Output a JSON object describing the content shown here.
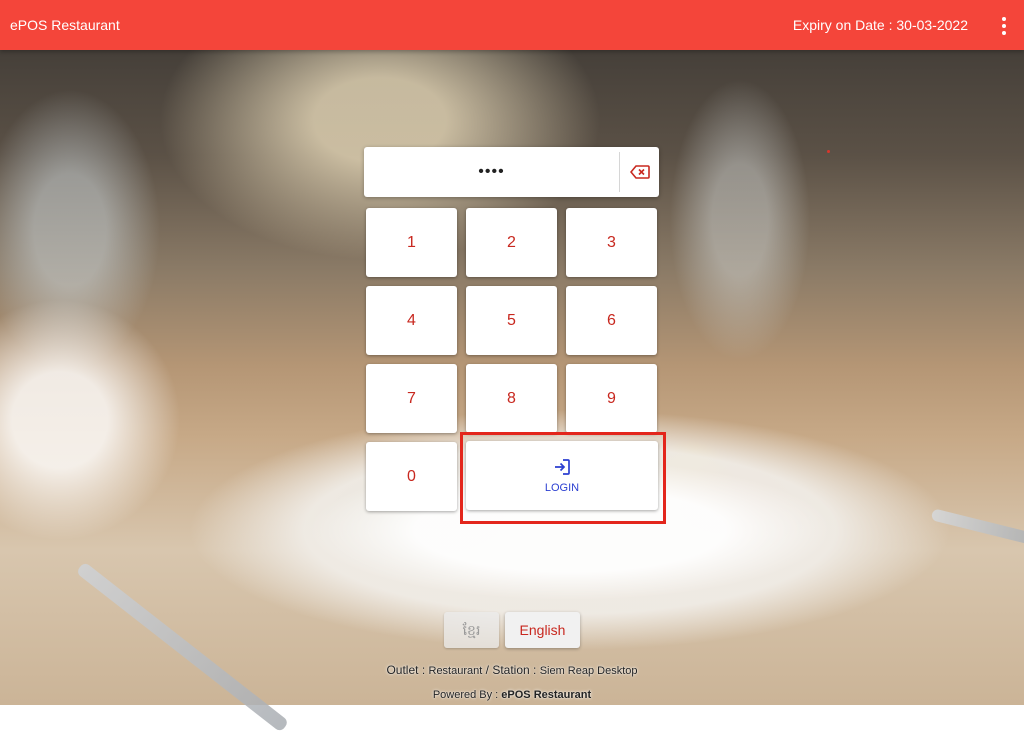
{
  "header": {
    "app_title": "ePOS Restaurant",
    "expiry": "Expiry on Date : 30-03-2022",
    "menu_icon": "more-vertical-icon"
  },
  "pin": {
    "value": "••••",
    "clear_icon": "backspace-icon"
  },
  "keypad": {
    "keys": [
      "1",
      "2",
      "3",
      "4",
      "5",
      "6",
      "7",
      "8",
      "9",
      "0"
    ],
    "login_label": "LOGIN",
    "login_icon": "login-icon"
  },
  "language": {
    "khmer": "ខ្មែរ",
    "english": "English"
  },
  "footer": {
    "outlet_label": "Outlet : ",
    "outlet_value": "Restaurant",
    "station_label": " / Station : ",
    "station_value": "Siem Reap Desktop",
    "powered_label": "Powered By : ",
    "powered_value": "ePOS Restaurant"
  },
  "colors": {
    "header": "#f4453a",
    "key_text": "#c8281f",
    "login_text": "#2b3fd1",
    "highlight": "#e3261c"
  }
}
